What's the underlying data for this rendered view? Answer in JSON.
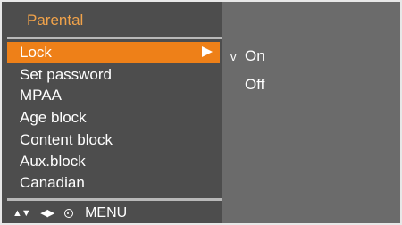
{
  "menu": {
    "title": "Parental",
    "items": [
      {
        "label": "Lock",
        "selected": true
      },
      {
        "label": "Set password"
      },
      {
        "label": "MPAA"
      },
      {
        "label": "Age block"
      },
      {
        "label": "Content block"
      },
      {
        "label": "Aux.block"
      },
      {
        "label": "Canadian"
      }
    ]
  },
  "submenu": {
    "options": [
      {
        "label": "On",
        "check": "v",
        "checked": true
      },
      {
        "label": "Off",
        "check": "",
        "checked": false
      }
    ]
  },
  "nav_hint": {
    "updown_glyph": "▲▼",
    "leftright_glyph": "◀▶",
    "circle_icon": "ok-icon",
    "menu_label": "MENU"
  },
  "colors": {
    "accent": "#ee8018",
    "title": "#f0a24a",
    "left_panel": "#4d4d4d",
    "right_panel": "#6b6b6b"
  }
}
